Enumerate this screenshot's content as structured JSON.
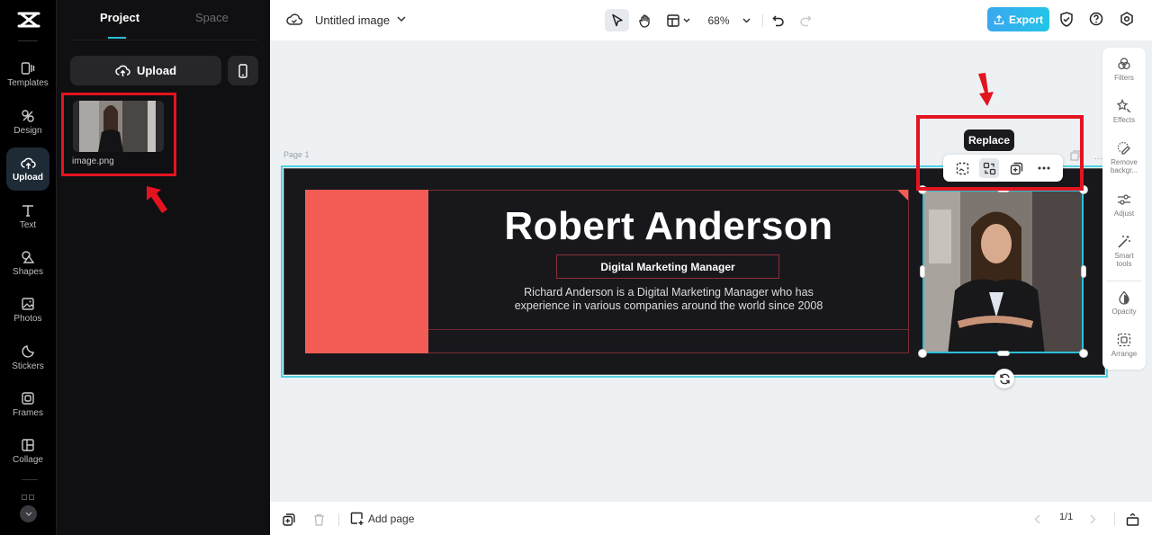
{
  "rail": {
    "items": [
      {
        "label": "Templates",
        "icon": "templates-icon"
      },
      {
        "label": "Design",
        "icon": "design-icon"
      },
      {
        "label": "Upload",
        "icon": "upload-cloud-icon",
        "active": true
      },
      {
        "label": "Text",
        "icon": "text-icon"
      },
      {
        "label": "Shapes",
        "icon": "shapes-icon"
      },
      {
        "label": "Photos",
        "icon": "photos-icon"
      },
      {
        "label": "Stickers",
        "icon": "stickers-icon"
      },
      {
        "label": "Frames",
        "icon": "frames-icon"
      },
      {
        "label": "Collage",
        "icon": "collage-icon"
      }
    ]
  },
  "panel": {
    "tabs": [
      "Project",
      "Space"
    ],
    "active_tab": "Project",
    "upload_label": "Upload",
    "files": [
      {
        "name": "image.png"
      }
    ]
  },
  "topbar": {
    "title": "Untitled image",
    "zoom": "68%",
    "export_label": "Export"
  },
  "canvas": {
    "page_label": "Page 1",
    "design": {
      "name": "Robert Anderson",
      "role": "Digital Marketing Manager",
      "desc_line1": "Richard Anderson is a Digital Marketing Manager who has",
      "desc_line2": "experience in various companies around the world since 2008"
    },
    "tooltip": "Replace",
    "context_actions": [
      "crop",
      "replace",
      "duplicate",
      "more"
    ]
  },
  "right_panel": {
    "items": [
      {
        "label": "Filters"
      },
      {
        "label": "Effects"
      },
      {
        "label": "Remove backgr..."
      },
      {
        "label": "Adjust"
      },
      {
        "label": "Smart tools"
      },
      {
        "label": "Opacity"
      },
      {
        "label": "Arrange"
      }
    ]
  },
  "bottombar": {
    "add_page_label": "Add page",
    "page_indicator": "1/1"
  },
  "colors": {
    "accent": "#2bc0d8",
    "export_start": "#3aa8f0",
    "annotation_red": "#e3141f",
    "coral": "#f25c55",
    "design_bg": "#18181c"
  }
}
